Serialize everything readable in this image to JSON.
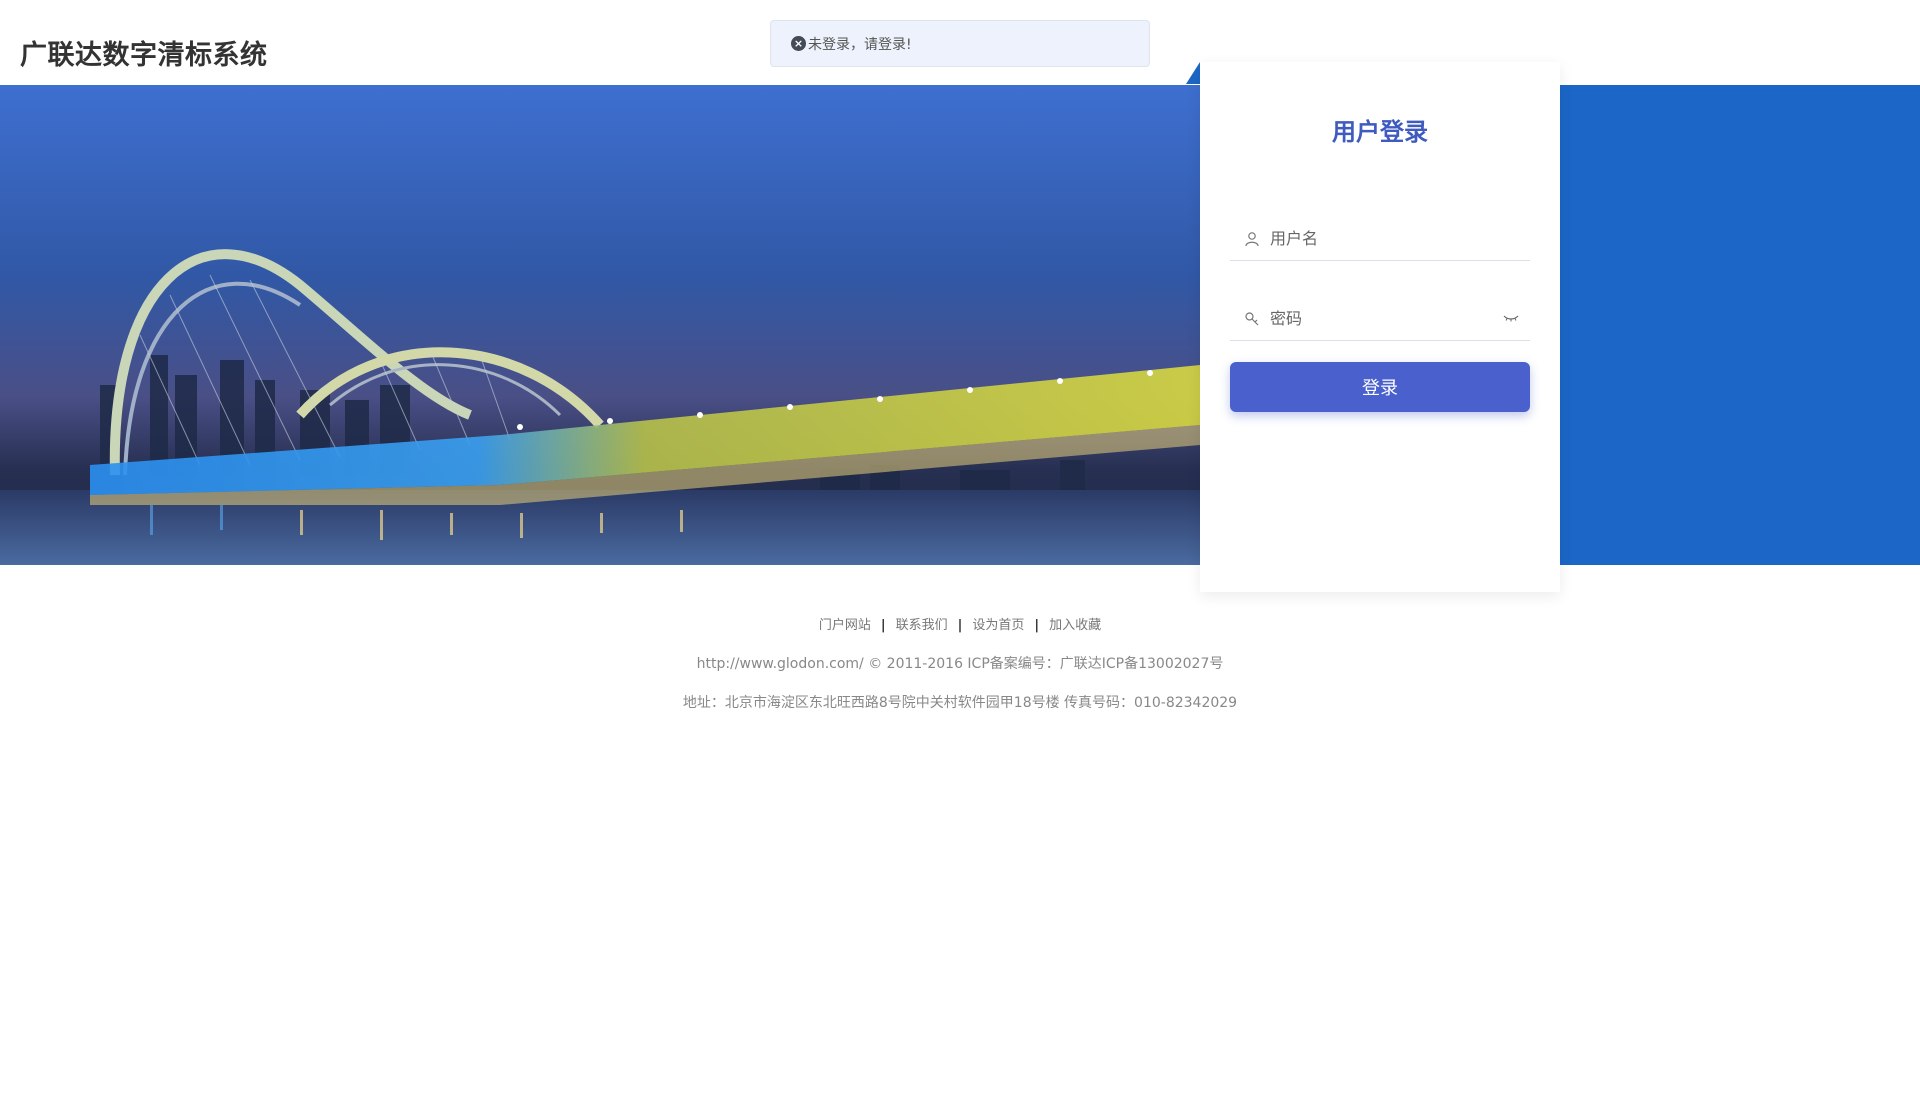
{
  "header": {
    "app_title": "广联达数字清标系统"
  },
  "toast": {
    "icon": "close-circle-icon",
    "message": "未登录，请登录!"
  },
  "login": {
    "title": "用户登录",
    "username_placeholder": "用户名",
    "password_placeholder": "密码",
    "username_icon": "user-icon",
    "password_icon": "key-icon",
    "eye_icon": "eye-closed-icon",
    "button_label": "登录"
  },
  "footer": {
    "links": [
      "门户网站",
      "联系我们",
      "设为首页",
      "加入收藏"
    ],
    "separator": "|",
    "copyright": "http://www.glodon.com/ © 2011-2016 ICP备案编号：广联达ICP备13002027号",
    "address": "地址：北京市海淀区东北旺西路8号院中关村软件园甲18号楼 传真号码：010-82342029"
  },
  "colors": {
    "accent": "#4a60cc",
    "title": "#3f5bc0",
    "banner_blue": "#1b66c6",
    "toast_bg": "#edf2fc"
  }
}
